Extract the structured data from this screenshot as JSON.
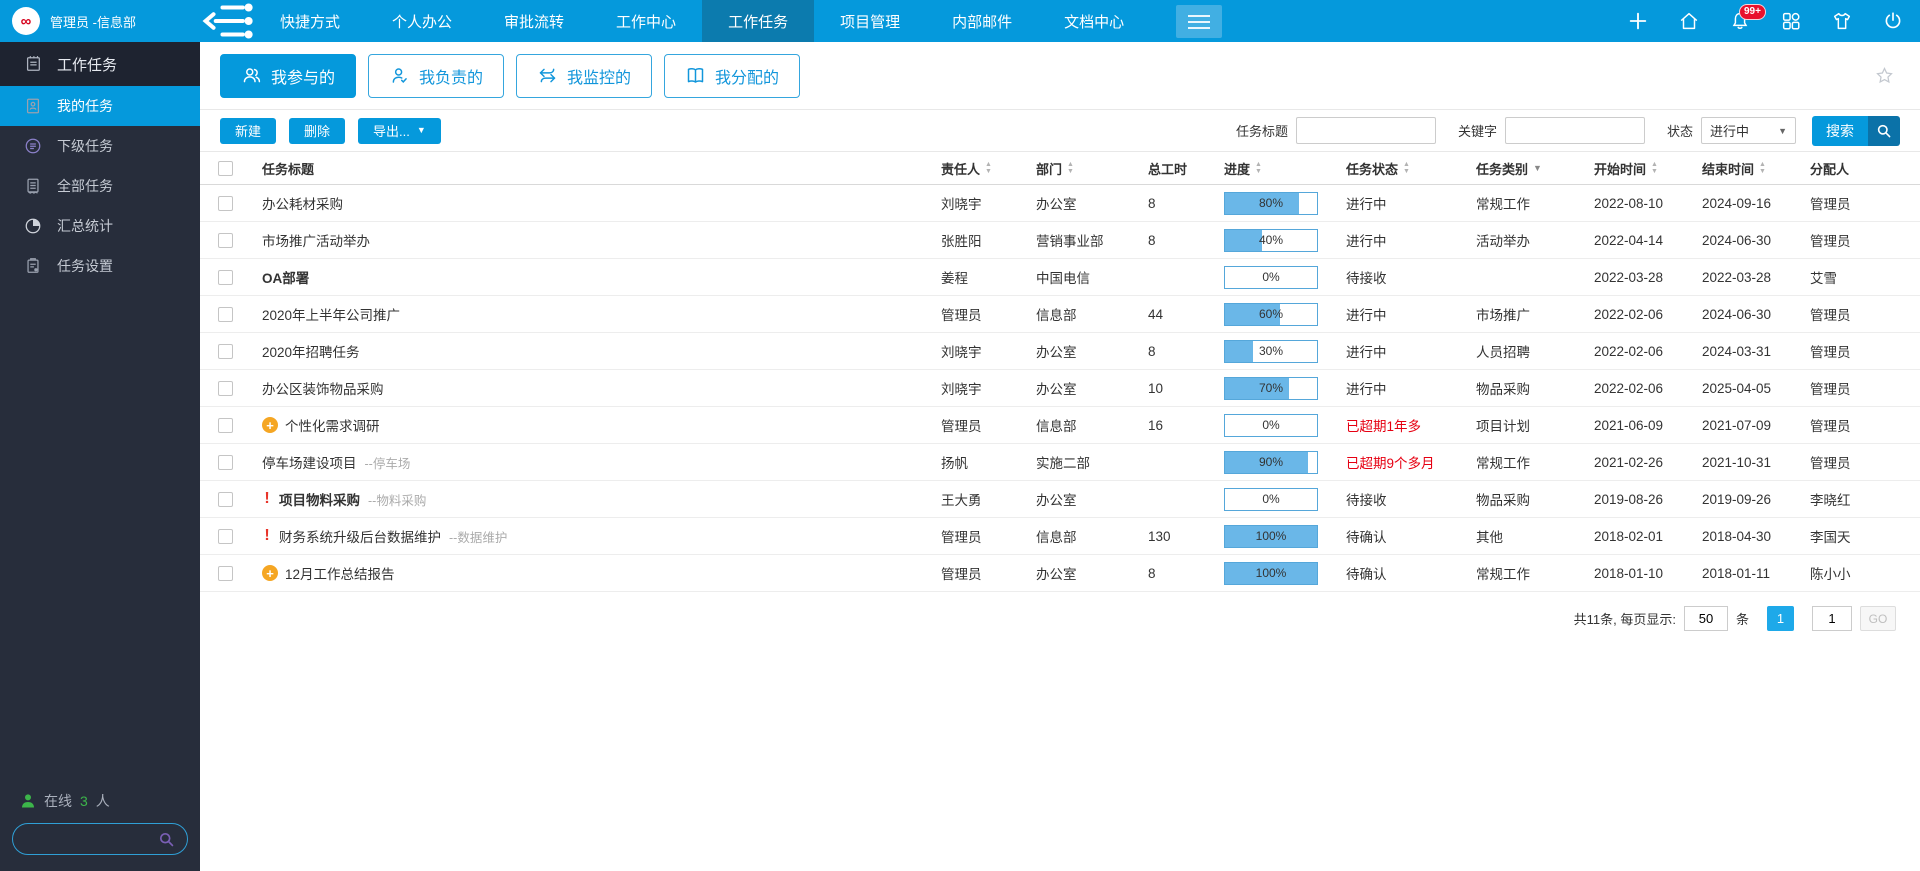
{
  "colors": {
    "topbar_blue": "#0599dc",
    "topbar_active": "#0c7bae",
    "sidebar_bg": "#272d3b",
    "accent_blue": "#1296db",
    "progress_fill": "#6ab7e8",
    "overdue_red": "#e60012",
    "badge_red": "#e8112d",
    "online_green": "#3cb54a",
    "page_active_blue": "#1ea9e9"
  },
  "topbar": {
    "logo_icon": "infinity-logo",
    "user_label": "管理员 -信息部",
    "collapse_icon": "collapse-menu",
    "menus": [
      {
        "label": "快捷方式"
      },
      {
        "label": "个人办公"
      },
      {
        "label": "审批流转"
      },
      {
        "label": "工作中心"
      },
      {
        "label": "工作任务",
        "active": true
      },
      {
        "label": "项目管理"
      },
      {
        "label": "内部邮件"
      },
      {
        "label": "文档中心"
      }
    ],
    "more_icon": "more-menus",
    "right_icons": [
      {
        "icon": "plus"
      },
      {
        "icon": "home"
      },
      {
        "icon": "bell",
        "badge": "99+"
      },
      {
        "icon": "apps"
      },
      {
        "icon": "theme-shirt"
      },
      {
        "icon": "power"
      }
    ]
  },
  "sidebar": {
    "header": {
      "label": "工作任务",
      "icon": "notebook"
    },
    "items": [
      {
        "label": "我的任务",
        "icon": "id-card",
        "active": true
      },
      {
        "label": "下级任务",
        "icon": "list-circle"
      },
      {
        "label": "全部任务",
        "icon": "document"
      },
      {
        "label": "汇总统计",
        "icon": "pie-chart"
      },
      {
        "label": "任务设置",
        "icon": "clipboard-gear"
      }
    ],
    "online": {
      "icon": "person",
      "label": "在线",
      "count": "3",
      "unit": "人"
    },
    "search_placeholder": ""
  },
  "filter_tabs": [
    {
      "label": "我参与的",
      "icon": "people",
      "active": true
    },
    {
      "label": "我负责的",
      "icon": "person-check"
    },
    {
      "label": "我监控的",
      "icon": "arrows-swap"
    },
    {
      "label": "我分配的",
      "icon": "open-book"
    }
  ],
  "star_icon": "favorite-star",
  "toolbar": {
    "new_label": "新建",
    "delete_label": "删除",
    "export_label": "导出...",
    "title_label": "任务标题",
    "title_value": "",
    "keyword_label": "关键字",
    "keyword_value": "",
    "status_label": "状态",
    "status_value": "进行中",
    "search_label": "搜索"
  },
  "table": {
    "columns": [
      {
        "label": "任务标题",
        "sort": "none"
      },
      {
        "label": "责任人",
        "sort": "both"
      },
      {
        "label": "部门",
        "sort": "both"
      },
      {
        "label": "总工时",
        "sort": "none"
      },
      {
        "label": "进度",
        "sort": "both"
      },
      {
        "label": "任务状态",
        "sort": "both"
      },
      {
        "label": "任务类别",
        "sort": "filter"
      },
      {
        "label": "开始时间",
        "sort": "both"
      },
      {
        "label": "结束时间",
        "sort": "both"
      },
      {
        "label": "分配人",
        "sort": "none"
      }
    ],
    "rows": [
      {
        "prefix": "",
        "title": "办公耗材采购",
        "bold": false,
        "suffix": "",
        "owner": "刘晓宇",
        "dept": "办公室",
        "hours": "8",
        "progress": 80,
        "status": "进行中",
        "overdue": false,
        "category": "常规工作",
        "start": "2022-08-10",
        "end": "2024-09-16",
        "assigner": "管理员"
      },
      {
        "prefix": "",
        "title": "市场推广活动举办",
        "bold": false,
        "suffix": "",
        "owner": "张胜阳",
        "dept": "营销事业部",
        "hours": "8",
        "progress": 40,
        "status": "进行中",
        "overdue": false,
        "category": "活动举办",
        "start": "2022-04-14",
        "end": "2024-06-30",
        "assigner": "管理员"
      },
      {
        "prefix": "",
        "title": "OA部署",
        "bold": true,
        "suffix": "",
        "owner": "姜程",
        "dept": "中国电信",
        "hours": "",
        "progress": 0,
        "status": "待接收",
        "overdue": false,
        "category": "",
        "start": "2022-03-28",
        "end": "2022-03-28",
        "assigner": "艾雪"
      },
      {
        "prefix": "",
        "title": "2020年上半年公司推广",
        "bold": false,
        "suffix": "",
        "owner": "管理员",
        "dept": "信息部",
        "hours": "44",
        "progress": 60,
        "status": "进行中",
        "overdue": false,
        "category": "市场推广",
        "start": "2022-02-06",
        "end": "2024-06-30",
        "assigner": "管理员"
      },
      {
        "prefix": "",
        "title": "2020年招聘任务",
        "bold": false,
        "suffix": "",
        "owner": "刘晓宇",
        "dept": "办公室",
        "hours": "8",
        "progress": 30,
        "status": "进行中",
        "overdue": false,
        "category": "人员招聘",
        "start": "2022-02-06",
        "end": "2024-03-31",
        "assigner": "管理员"
      },
      {
        "prefix": "",
        "title": "办公区装饰物品采购",
        "bold": false,
        "suffix": "",
        "owner": "刘晓宇",
        "dept": "办公室",
        "hours": "10",
        "progress": 70,
        "status": "进行中",
        "overdue": false,
        "category": "物品采购",
        "start": "2022-02-06",
        "end": "2025-04-05",
        "assigner": "管理员"
      },
      {
        "prefix": "plus-circle",
        "title": "个性化需求调研",
        "bold": false,
        "suffix": "",
        "owner": "管理员",
        "dept": "信息部",
        "hours": "16",
        "progress": 0,
        "status": "已超期1年多",
        "overdue": true,
        "category": "项目计划",
        "start": "2021-06-09",
        "end": "2021-07-09",
        "assigner": "管理员"
      },
      {
        "prefix": "",
        "title": "停车场建设项目",
        "bold": false,
        "suffix": "--停车场",
        "owner": "扬帆",
        "dept": "实施二部",
        "hours": "",
        "progress": 90,
        "status": "已超期9个多月",
        "overdue": true,
        "category": "常规工作",
        "start": "2021-02-26",
        "end": "2021-10-31",
        "assigner": "管理员"
      },
      {
        "prefix": "exclamation",
        "title": "项目物料采购",
        "bold": true,
        "suffix": "--物料采购",
        "owner": "王大勇",
        "dept": "办公室",
        "hours": "",
        "progress": 0,
        "status": "待接收",
        "overdue": false,
        "category": "物品采购",
        "start": "2019-08-26",
        "end": "2019-09-26",
        "assigner": "李晓红"
      },
      {
        "prefix": "exclamation",
        "title": "财务系统升级后台数据维护",
        "bold": false,
        "suffix": "--数据维护",
        "owner": "管理员",
        "dept": "信息部",
        "hours": "130",
        "progress": 100,
        "status": "待确认",
        "overdue": false,
        "category": "其他",
        "start": "2018-02-01",
        "end": "2018-04-30",
        "assigner": "李国天"
      },
      {
        "prefix": "plus-circle",
        "title": "12月工作总结报告",
        "bold": false,
        "suffix": "",
        "owner": "管理员",
        "dept": "办公室",
        "hours": "8",
        "progress": 100,
        "status": "待确认",
        "overdue": false,
        "category": "常规工作",
        "start": "2018-01-10",
        "end": "2018-01-11",
        "assigner": "陈小小"
      }
    ]
  },
  "pagination": {
    "summary": "共11条, 每页显示:",
    "page_size": "50",
    "unit": "条",
    "current_page": "1",
    "page_input": "1",
    "go_label": "GO"
  }
}
